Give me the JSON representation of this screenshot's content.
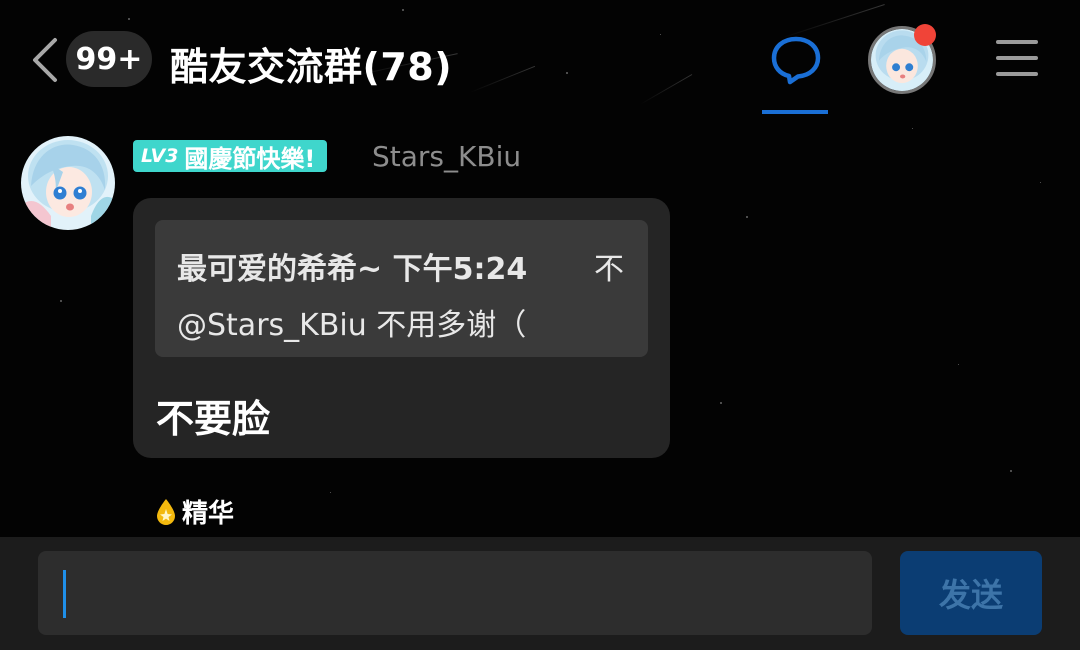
{
  "header": {
    "back_icon": "chevron-left-icon",
    "unread_count": "99+",
    "group_title": "酷友交流群(78)",
    "chat_tab_icon": "chat-bubble-icon",
    "menu_icon": "hamburger-menu-icon",
    "accent_color": "#1a6fd6",
    "notification_dot_color": "#f04438"
  },
  "message": {
    "level": "LV3",
    "badge_title": "國慶節快樂!",
    "badge_color": "#3fd6cc",
    "username": "Stars_KBiu",
    "quote": {
      "author_time": "最可爱的希希~ 下午5:24",
      "corner": "不",
      "text": "@Stars_KBiu 不用多谢（"
    },
    "text": "不要脸"
  },
  "essence": {
    "icon": "drop-icon",
    "label": "精华"
  },
  "composer": {
    "input_value": "",
    "send_label": "发送",
    "send_color": "#0b3d73"
  }
}
